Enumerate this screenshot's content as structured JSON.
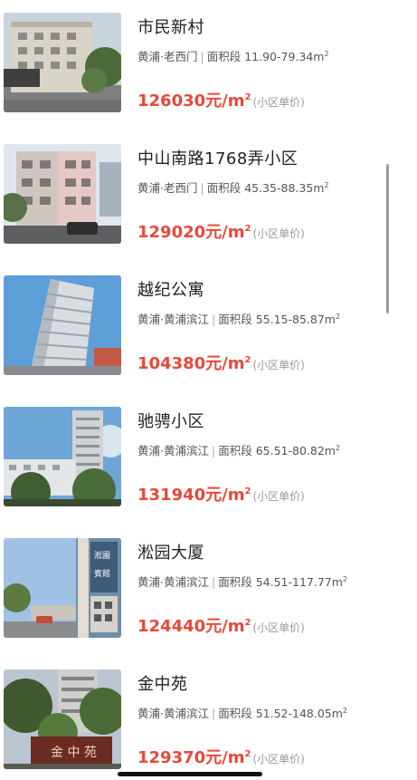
{
  "listings": [
    {
      "name": "市民新村",
      "district": "黄浦·老西门",
      "area_label": "面积段",
      "area_range": "11.90-79.34m",
      "area_unit_sup": "2",
      "price": "126030",
      "price_unit": "元/m",
      "price_unit_sup": "2",
      "price_note": "(小区单价)"
    },
    {
      "name": "中山南路1768弄小区",
      "district": "黄浦·老西门",
      "area_label": "面积段",
      "area_range": "45.35-88.35m",
      "area_unit_sup": "2",
      "price": "129020",
      "price_unit": "元/m",
      "price_unit_sup": "2",
      "price_note": "(小区单价)"
    },
    {
      "name": "越纪公寓",
      "district": "黄浦·黄浦滨江",
      "area_label": "面积段",
      "area_range": "55.15-85.87m",
      "area_unit_sup": "2",
      "price": "104380",
      "price_unit": "元/m",
      "price_unit_sup": "2",
      "price_note": "(小区单价)"
    },
    {
      "name": "驰骋小区",
      "district": "黄浦·黄浦滨江",
      "area_label": "面积段",
      "area_range": "65.51-80.82m",
      "area_unit_sup": "2",
      "price": "131940",
      "price_unit": "元/m",
      "price_unit_sup": "2",
      "price_note": "(小区单价)"
    },
    {
      "name": "淞园大厦",
      "district": "黄浦·黄浦滨江",
      "area_label": "面积段",
      "area_range": "54.51-117.77m",
      "area_unit_sup": "2",
      "price": "124440",
      "price_unit": "元/m",
      "price_unit_sup": "2",
      "price_note": "(小区单价)"
    },
    {
      "name": "金中苑",
      "district": "黄浦·黄浦滨江",
      "area_label": "面积段",
      "area_range": "51.52-148.05m",
      "area_unit_sup": "2",
      "price": "129370",
      "price_unit": "元/m",
      "price_unit_sup": "2",
      "price_note": "(小区单价)"
    }
  ],
  "photo_signs": {
    "songyuan": "淞园宾馆",
    "jinzhong": "金中苑"
  },
  "colors": {
    "price": "#e8483a",
    "title": "#1f1f1f",
    "meta": "#555555",
    "note": "#999999"
  }
}
